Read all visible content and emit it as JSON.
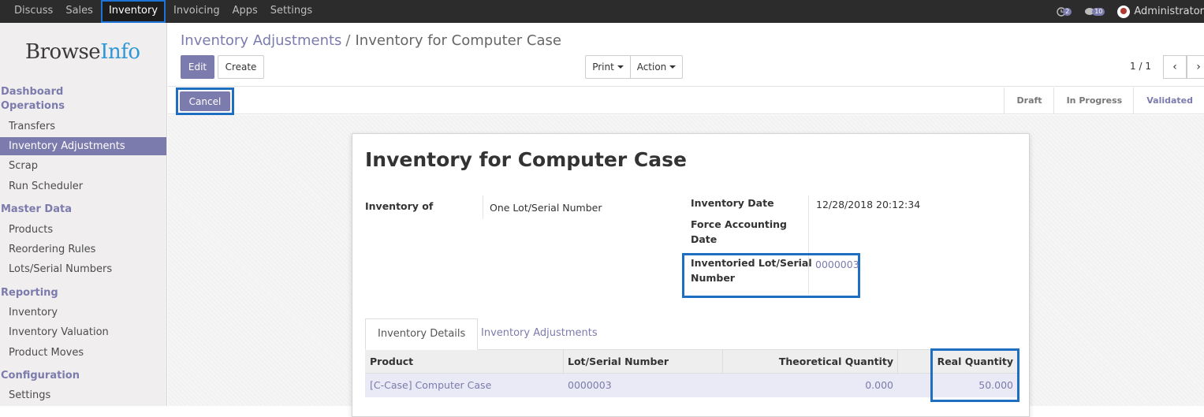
{
  "topbar": {
    "menu": [
      "Discuss",
      "Sales",
      "Inventory",
      "Invoicing",
      "Apps",
      "Settings"
    ],
    "active_menu": "Inventory",
    "activity_count": "2",
    "message_count": "10",
    "user": "Administrator"
  },
  "sidebar": {
    "logo_main": "Browse",
    "logo_accent": "Info",
    "sections": [
      {
        "title": "Dashboard",
        "items": []
      },
      {
        "title": "Operations",
        "items": [
          "Transfers",
          "Inventory Adjustments",
          "Scrap",
          "Run Scheduler"
        ]
      },
      {
        "title": "Master Data",
        "items": [
          "Products",
          "Reordering Rules",
          "Lots/Serial Numbers"
        ]
      },
      {
        "title": "Reporting",
        "items": [
          "Inventory",
          "Inventory Valuation",
          "Product Moves"
        ]
      },
      {
        "title": "Configuration",
        "items": [
          "Settings"
        ]
      }
    ],
    "active_item": "Inventory Adjustments"
  },
  "breadcrumb": {
    "parent": "Inventory Adjustments",
    "separator": "/",
    "current": "Inventory for Computer Case"
  },
  "toolbar": {
    "edit": "Edit",
    "create": "Create",
    "print": "Print",
    "action": "Action"
  },
  "pager": {
    "value": "1 / 1",
    "prev": "‹",
    "next": "›"
  },
  "statusbar": {
    "cancel": "Cancel",
    "stages": [
      "Draft",
      "In Progress",
      "Validated"
    ],
    "current_stage": "Validated"
  },
  "form": {
    "title": "Inventory for Computer Case",
    "inventory_of_label": "Inventory of",
    "inventory_of_value": "One Lot/Serial Number",
    "date_label": "Inventory Date",
    "date_value": "12/28/2018 20:12:34",
    "force_label_1": "Force Accounting",
    "force_label_2": "Date",
    "lot_label_1": "Inventoried Lot/Serial",
    "lot_label_2": "Number",
    "lot_value": "0000003"
  },
  "tabs": [
    "Inventory Details",
    "Inventory Adjustments"
  ],
  "table": {
    "headers": [
      "Product",
      "Lot/Serial Number",
      "Theoretical Quantity",
      "Real Quantity"
    ],
    "rows": [
      {
        "product": "[C-Case] Computer Case",
        "lot": "0000003",
        "theoretical": "0.000",
        "real": "50.000"
      }
    ]
  },
  "colors": {
    "accent": "#7c7bad",
    "highlight_border": "#1e6fc2",
    "navbar": "#2c2c2c"
  }
}
